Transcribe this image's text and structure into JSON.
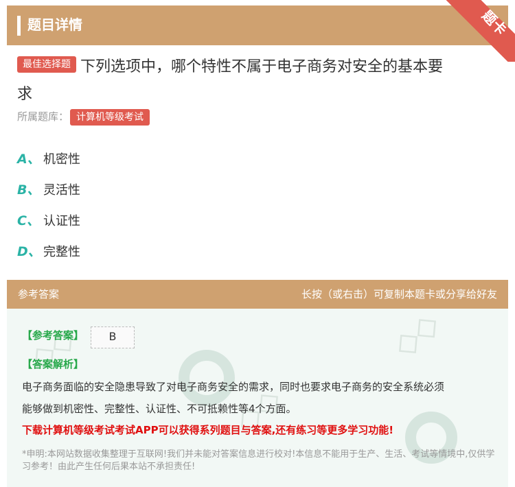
{
  "header": {
    "title": "题目详情",
    "ribbon": "题卡"
  },
  "question": {
    "badge": "最佳选择题",
    "text_line1": "下列选项中，哪个特性不属于电子商务对安全的基本要",
    "text_line2": "求"
  },
  "category": {
    "label": "所属题库：",
    "value": "计算机等级考试"
  },
  "options": [
    {
      "letter": "A、",
      "text": "机密性"
    },
    {
      "letter": "B、",
      "text": "灵活性"
    },
    {
      "letter": "C、",
      "text": "认证性"
    },
    {
      "letter": "D、",
      "text": "完整性"
    }
  ],
  "answer_section": {
    "left_title": "参考答案",
    "right_hint": "长按（或右击）可复制本题卡或分享给好友",
    "ref_label": "【参考答案】",
    "ref_value": "B",
    "analysis_label": "【答案解析】",
    "analysis_line1": "电子商务面临的安全隐患导致了对电子商务安全的需求，同时也要求电子商务的安全系统必须",
    "analysis_line2": "能够做到机密性、完整性、认证性、不可抵赖性等4个方面。",
    "promo": "下载计算机等级考试考试APP可以获得系列题目与答案,还有练习等更多学习功能!",
    "disclaimer": "*申明:本网站数据收集整理于互联网!我们并未能对答案信息进行校对!本信息不能用于生产、生活、考试等情境中,仅供学习参考！由此产生任何后果本站不承担责任!"
  }
}
